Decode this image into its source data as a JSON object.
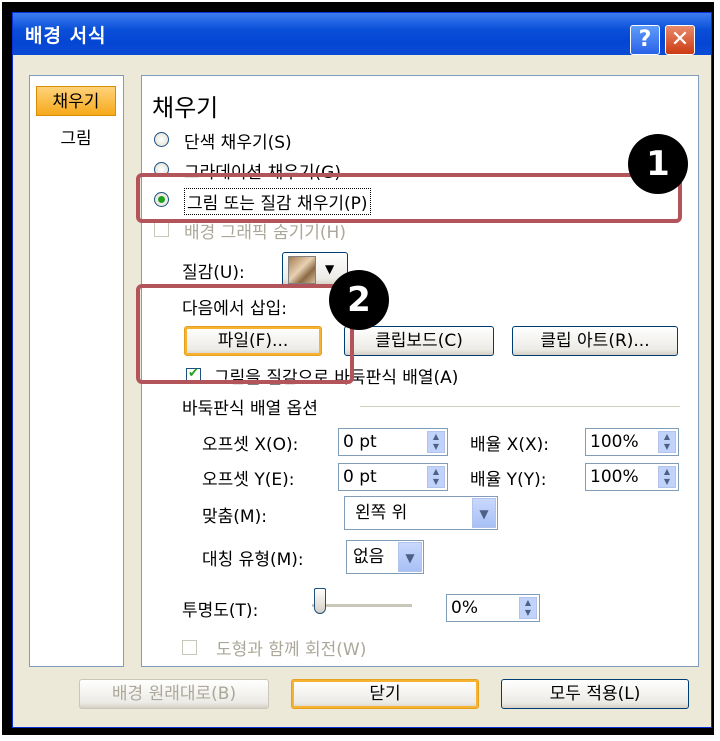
{
  "window": {
    "title": "배경 서식",
    "help_label": "?",
    "close_label": "✕"
  },
  "sidebar": {
    "items": [
      {
        "label": "채우기"
      },
      {
        "label": "그림"
      }
    ]
  },
  "fill": {
    "heading": "채우기",
    "solid_label": "단색 채우기(S)",
    "gradient_label": "그라데이션 채우기(G)",
    "picture_label": "그림 또는 질감 채우기(P)",
    "hide_bg_label": "배경 그래픽 숨기기(H)",
    "texture_label": "질감(U):",
    "insert_from_label": "다음에서 삽입:",
    "file_button": "파일(F)...",
    "clipboard_button": "클립보드(C)",
    "clipart_button": "클립 아트(R)...",
    "tile_label": "그림을 질감으로 바둑판식 배열(A)"
  },
  "tiling": {
    "section_label": "바둑판식 배열 옵션",
    "offset_x_label": "오프셋 X(O):",
    "offset_x_value": "0 pt",
    "offset_y_label": "오프셋 Y(E):",
    "offset_y_value": "0 pt",
    "scale_x_label": "배율 X(X):",
    "scale_x_value": "100%",
    "scale_y_label": "배율 Y(Y):",
    "scale_y_value": "100%",
    "align_label": "맞춤(M):",
    "align_value": "왼쪽 위",
    "mirror_label": "대칭 유형(M):",
    "mirror_value": "없음"
  },
  "transparency": {
    "label": "투명도(T):",
    "value": "0%",
    "level": 0
  },
  "rotate_label": "도형과 함께 회전(W)",
  "footer": {
    "reset_button": "배경 원래대로(B)",
    "close_button": "닫기",
    "apply_all_button": "모두 적용(L)"
  },
  "annotations": {
    "badge1": "1",
    "badge2": "2"
  },
  "colors": {
    "annotation_border": "#b3535a",
    "title_bar": "#0a4fd8",
    "selected_tab": "#f6a91a"
  }
}
